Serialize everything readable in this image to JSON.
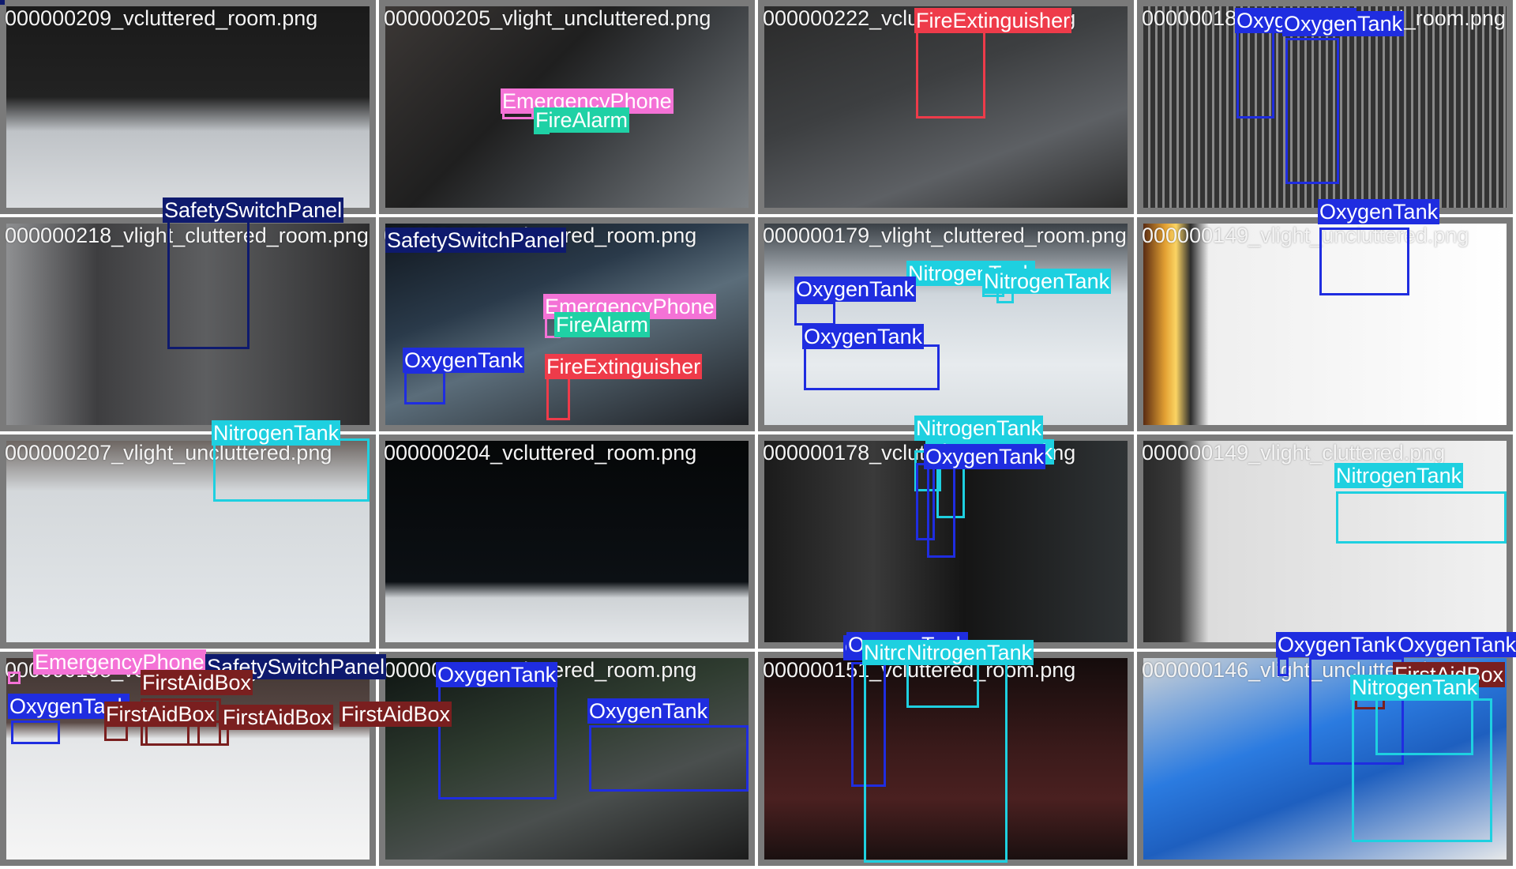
{
  "colors": {
    "OxygenTank": "#1f2de0",
    "NitrogenTank": "#1ed0e0",
    "FireExtinguisher": "#ee3b4a",
    "FireAlarm": "#1fd1a5",
    "EmergencyPhone": "#f472d6",
    "SafetySwitchPanel": "#0e1a6e",
    "FirstAidBox": "#7a1f1f",
    "label_text": "#ffffff",
    "tile_border": "#7a7a7a"
  },
  "tiles": [
    {
      "filename": "000000209_vcluttered_room.png",
      "scene": "dark-corner",
      "boxes": []
    },
    {
      "filename": "000000205_vlight_uncluttered.png",
      "scene": "dark-panel",
      "boxes": [
        {
          "label": "EmergencyPhone"
        },
        {
          "label": "FireAlarm"
        }
      ]
    },
    {
      "filename": "000000222_vcluttered_room.png",
      "scene": "dark-floor",
      "boxes": [
        {
          "label": "FireExtinguisher"
        }
      ]
    },
    {
      "filename": "000000184_vlight_cluttered_room.png",
      "scene": "grating",
      "boxes": [
        {
          "label": "OxygenTank"
        },
        {
          "label": "OxygenTank"
        }
      ]
    },
    {
      "filename": "000000218_vlight_cluttered_room.png",
      "scene": "wall-panel",
      "boxes": [
        {
          "label": "SafetySwitchPanel"
        }
      ]
    },
    {
      "filename": "000000191_vcluttered_room.png",
      "scene": "dark-deck",
      "boxes": [
        {
          "label": "SafetySwitchPanel"
        },
        {
          "label": "EmergencyPhone"
        },
        {
          "label": "FireAlarm"
        },
        {
          "label": "OxygenTank"
        },
        {
          "label": "FireExtinguisher"
        }
      ]
    },
    {
      "filename": "000000179_vlight_cluttered_room.png",
      "scene": "white-floor",
      "boxes": [
        {
          "label": "NitrogenTank"
        },
        {
          "label": "NitrogenTank"
        },
        {
          "label": "OxygenTank"
        },
        {
          "label": "OxygenTank"
        }
      ]
    },
    {
      "filename": "000000149_vlight_uncluttered.png",
      "scene": "bright-corner",
      "boxes": [
        {
          "label": "OxygenTank"
        }
      ]
    },
    {
      "filename": "000000207_vlight_uncluttered.png",
      "scene": "white-plane",
      "boxes": [
        {
          "label": "NitrogenTank"
        }
      ]
    },
    {
      "filename": "000000204_vcluttered_room.png",
      "scene": "dark-empty",
      "boxes": []
    },
    {
      "filename": "000000178_vcluttered_room.png",
      "scene": "dark-shaft",
      "boxes": [
        {
          "label": "NitrogenTank"
        },
        {
          "label": "NitrogenTank"
        },
        {
          "label": "OxygenTank"
        },
        {
          "label": "OxygenTank"
        }
      ]
    },
    {
      "filename": "000000149_vlight_cluttered.png",
      "scene": "white-room",
      "boxes": [
        {
          "label": "NitrogenTank"
        }
      ]
    },
    {
      "filename": "000000168_vcluttered.png",
      "scene": "white-hall",
      "boxes": [
        {
          "label": "EmergencyPhone"
        },
        {
          "label": "SafetySwitchPanel"
        },
        {
          "label": "FirstAidBox"
        },
        {
          "label": "OxygenTank"
        },
        {
          "label": "FirstAidBox"
        },
        {
          "label": "FirstAidBox"
        },
        {
          "label": "FirstAidBox"
        }
      ]
    },
    {
      "filename": "000000182_vcluttered_room.png",
      "scene": "green-tanks",
      "boxes": [
        {
          "label": "OxygenTank"
        },
        {
          "label": "OxygenTank"
        }
      ]
    },
    {
      "filename": "000000151_vcluttered_room.png",
      "scene": "dark-red",
      "boxes": [
        {
          "label": "OxygenTank"
        },
        {
          "label": "NitrogenTank"
        },
        {
          "label": "NitrogenTank"
        }
      ]
    },
    {
      "filename": "000000146_vlight_uncluttered.png",
      "scene": "blue-crate",
      "boxes": [
        {
          "label": "OxygenTank"
        },
        {
          "label": "OxygenTank"
        },
        {
          "label": "FirstAidBox"
        },
        {
          "label": "NitrogenTank"
        },
        {
          "label": "NitrogenTank"
        }
      ]
    }
  ]
}
